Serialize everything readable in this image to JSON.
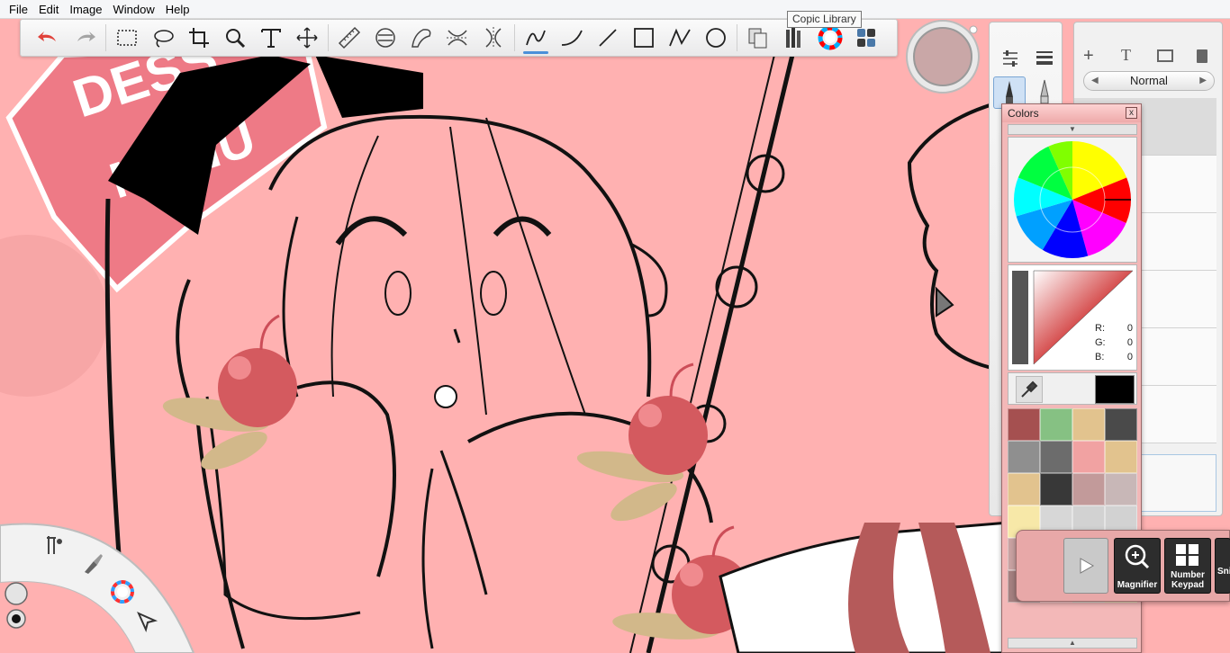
{
  "menu": [
    "File",
    "Edit",
    "Image",
    "Window",
    "Help"
  ],
  "tooltip": "Copic Library",
  "toolbar": {
    "tools": [
      "undo-icon",
      "redo-icon",
      "select-rect-icon",
      "lasso-icon",
      "crop-icon",
      "zoom-icon",
      "text-icon",
      "move-icon",
      "ruler-icon",
      "ellipse-guide-icon",
      "french-curve-icon",
      "symmetry-icon",
      "symmetry-y-icon",
      "pencil-curve-icon",
      "stroke-curve-icon",
      "line-icon",
      "rectangle-icon",
      "polyline-icon",
      "ellipse-icon",
      "copy-icon",
      "copic-library-icon",
      "color-wheel-icon",
      "lagoon-grid-icon"
    ],
    "active": "pencil-curve-icon"
  },
  "layers": {
    "blend_mode": "Normal"
  },
  "colors_panel": {
    "title": "Colors",
    "close": "x",
    "r_label": "R:",
    "g_label": "G:",
    "b_label": "B:",
    "r": "0",
    "g": "0",
    "b": "0",
    "current_color": "#000000",
    "swatches": [
      "#a55050",
      "#86c183",
      "#e2c38e",
      "#4a4a4a",
      "#8f8f8f",
      "#6c6c6c",
      "#f1a2a2",
      "#e2c38e",
      "#e2c38e",
      "#383838",
      "#c29a9a",
      "#c8b7b7",
      "#f7e8a8",
      "#d7d7d7",
      "#d2d2d2",
      "#d2d2d2",
      "#c9a2a2",
      "#ffb1b1",
      "#d2c4a8",
      "#e2c38e",
      "#a58080",
      "#ffb1b1",
      "#cfc6b4",
      "#e2c38e"
    ]
  },
  "tray": {
    "magnifier": "Magnifier",
    "number_keypad_1": "Number",
    "number_keypad_2": "Keypad",
    "snip": "Sni"
  },
  "canvas": {
    "background": "#ffb1b1"
  }
}
